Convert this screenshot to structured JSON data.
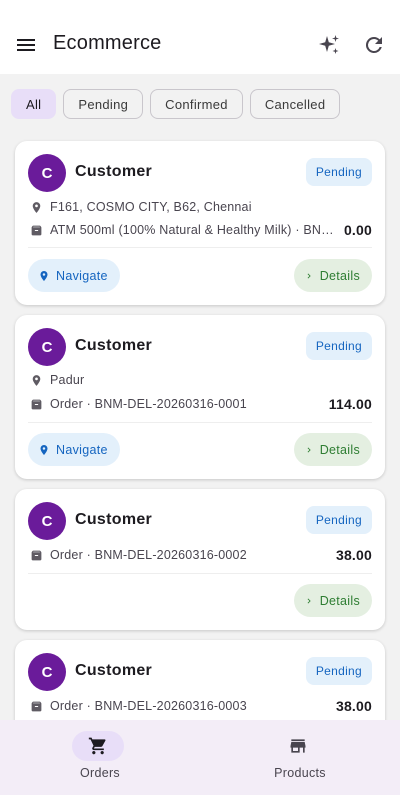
{
  "app": {
    "title": "Ecommerce"
  },
  "filters": [
    "All",
    "Pending",
    "Confirmed",
    "Cancelled"
  ],
  "orders": [
    {
      "initial": "C",
      "customer": "Customer",
      "status": "Pending",
      "address": "F161, COSMO CITY, B62, Chennai",
      "item": "ATM 500ml (100% Natural & Healthy Milk) · BNM-DEL-20260316-0000",
      "amount": "0.00",
      "navigate": "Navigate",
      "details": "Details"
    },
    {
      "initial": "C",
      "customer": "Customer",
      "status": "Pending",
      "address": "Padur",
      "item": "Order · BNM-DEL-20260316-0001",
      "amount": "114.00",
      "navigate": "Navigate",
      "details": "Details"
    },
    {
      "initial": "C",
      "customer": "Customer",
      "status": "Pending",
      "item": "Order · BNM-DEL-20260316-0002",
      "amount": "38.00",
      "details": "Details"
    },
    {
      "initial": "C",
      "customer": "Customer",
      "status": "Pending",
      "item": "Order · BNM-DEL-20260316-0003",
      "amount": "38.00"
    }
  ],
  "bottom_nav": [
    {
      "label": "Orders",
      "icon": "cart-icon",
      "active": true
    },
    {
      "label": "Products",
      "icon": "store-icon",
      "active": false
    }
  ],
  "colors": {
    "accent": "#6a1b9a",
    "status_blue": "#1565c0",
    "details_green": "#2e7d32",
    "chip_selected": "#e8def8"
  }
}
